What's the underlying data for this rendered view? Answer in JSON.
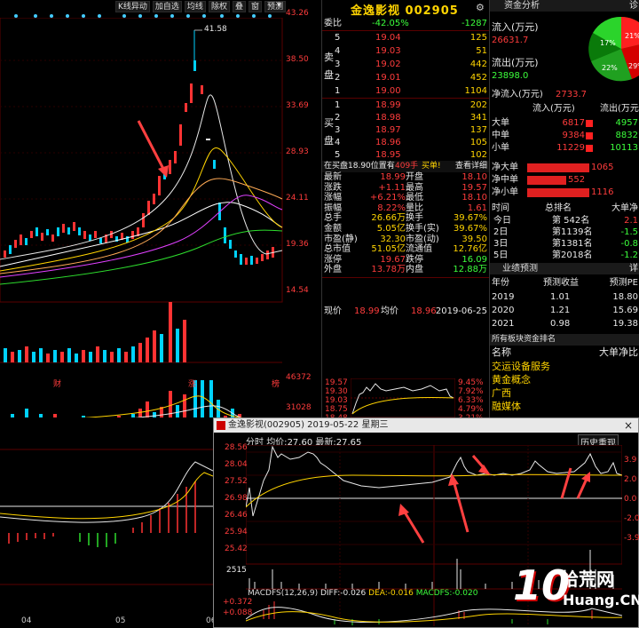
{
  "toolbar": [
    "K线异动",
    "加自选",
    "均线",
    "除权",
    "叠",
    "窗",
    "预测"
  ],
  "kline": {
    "prices": [
      "43.26",
      "38.50",
      "33.69",
      "28.93",
      "24.11",
      "19.36",
      "14.54"
    ],
    "peak": "41.58",
    "markers": [
      "财",
      "涨",
      "榜"
    ],
    "volume_axis": [
      "46372",
      "31028",
      "15685"
    ],
    "dates": [
      "04",
      "05",
      "06"
    ]
  },
  "quote": {
    "title": "金逸影视 002905",
    "weibi_label": "委比",
    "weibi_pct": "-42.05%",
    "weibi_diff": "-1287",
    "sell_label": [
      "卖",
      "盘"
    ],
    "buy_label": [
      "买",
      "盘"
    ],
    "sell": [
      {
        "lvl": "5",
        "price": "19.04",
        "vol": "125"
      },
      {
        "lvl": "4",
        "price": "19.03",
        "vol": "51"
      },
      {
        "lvl": "3",
        "price": "19.02",
        "vol": "442"
      },
      {
        "lvl": "2",
        "price": "19.01",
        "vol": "452"
      },
      {
        "lvl": "1",
        "price": "19.00",
        "vol": "1104"
      }
    ],
    "buy": [
      {
        "lvl": "1",
        "price": "18.99",
        "vol": "202"
      },
      {
        "lvl": "2",
        "price": "18.98",
        "vol": "341"
      },
      {
        "lvl": "3",
        "price": "18.97",
        "vol": "137"
      },
      {
        "lvl": "4",
        "price": "18.96",
        "vol": "105"
      },
      {
        "lvl": "5",
        "price": "18.95",
        "vol": "102"
      }
    ],
    "buy_notice": "在买盘18.90位置有",
    "buy_notice_vol": "409手",
    "buy_notice_btn": "买单!",
    "detail_btn": "查看详细",
    "stats": [
      {
        "l1": "最新",
        "v1": "18.99",
        "c1": "red",
        "l2": "开盘",
        "v2": "18.10",
        "c2": "red"
      },
      {
        "l1": "涨跌",
        "v1": "+1.11",
        "c1": "red",
        "l2": "最高",
        "v2": "19.57",
        "c2": "red"
      },
      {
        "l1": "涨幅",
        "v1": "+6.21%",
        "c1": "red",
        "l2": "最低",
        "v2": "18.10",
        "c2": "red"
      },
      {
        "l1": "振幅",
        "v1": "8.22%",
        "c1": "red",
        "l2": "量比",
        "v2": "1.61",
        "c2": "red"
      },
      {
        "l1": "总手",
        "v1": "26.66万",
        "c1": "yellow",
        "l2": "换手",
        "v2": "39.67%",
        "c2": "yellow"
      },
      {
        "l1": "金额",
        "v1": "5.05亿",
        "c1": "yellow",
        "l2": "换手(实)",
        "v2": "39.67%",
        "c2": "yellow"
      },
      {
        "l1": "市盈(静)",
        "v1": "32.30",
        "c1": "yellow",
        "l2": "市盈(动)",
        "v2": "39.50",
        "c2": "yellow"
      },
      {
        "l1": "总市值",
        "v1": "51.05亿",
        "c1": "yellow",
        "l2": "流通值",
        "v2": "12.76亿",
        "c2": "yellow"
      },
      {
        "l1": "涨停",
        "v1": "19.67",
        "c1": "red",
        "l2": "跌停",
        "v2": "16.09",
        "c2": "green"
      },
      {
        "l1": "外盘",
        "v1": "13.78万",
        "c1": "red",
        "l2": "内盘",
        "v2": "12.88万",
        "c2": "green"
      }
    ],
    "now_label": "现价",
    "now_price": "18.99",
    "avg_label": "均价",
    "avg_price": "18.96",
    "date": "2019-06-25",
    "mini_left": [
      "19.57",
      "19.30",
      "19.03",
      "18.75",
      "18.48"
    ],
    "mini_right": [
      "9.45%",
      "7.92%",
      "6.33%",
      "4.79%",
      "3.21%"
    ]
  },
  "right": {
    "header": "资金分析",
    "header_btn": "诊",
    "inflow_label": "流入(万元)",
    "inflow": "26631.7",
    "outflow_label": "流出(万元)",
    "outflow": "23898.0",
    "pie": [
      {
        "pct": "17%",
        "color": "#2bd42b"
      },
      {
        "pct": "21%",
        "color": "#ff2020"
      },
      {
        "pct": "22%",
        "color": "#20a020"
      },
      {
        "pct": "29%",
        "color": "#d40000"
      },
      {
        "pct": "11%",
        "color": "#0a7a0a"
      }
    ],
    "netflow_label": "净流入(万元)",
    "netflow": "2733.7",
    "flow_cols": [
      "流入(万元)",
      "流出(万元)"
    ],
    "flows": [
      {
        "name": "大单",
        "in": "6817",
        "out": "4957"
      },
      {
        "name": "中单",
        "in": "9384",
        "out": "8832"
      },
      {
        "name": "小单",
        "in": "11229",
        "out": "10113"
      }
    ],
    "net": [
      {
        "name": "净大单",
        "value": "1065"
      },
      {
        "name": "净中单",
        "value": "552"
      },
      {
        "name": "净小单",
        "value": "1116"
      }
    ],
    "rank_cols": [
      "时间",
      "总排名",
      "大单净"
    ],
    "rank": [
      {
        "t": "今日",
        "r": "第 542名",
        "v": "2.1"
      },
      {
        "t": "2日",
        "r": "第1139名",
        "v": "-1.5"
      },
      {
        "t": "3日",
        "r": "第1381名",
        "v": "-0.8"
      },
      {
        "t": "5日",
        "r": "第2018名",
        "v": "-1.2"
      }
    ],
    "forecast_header": "业绩预测",
    "forecast_btn": "详",
    "forecast_cols": [
      "年份",
      "预测收益",
      "预测PE"
    ],
    "forecast": [
      {
        "y": "2019",
        "e": "1.01",
        "pe": "18.80"
      },
      {
        "y": "2020",
        "e": "1.21",
        "pe": "15.69"
      },
      {
        "y": "2021",
        "e": "0.98",
        "pe": "19.38"
      }
    ],
    "board_header": "所有板块资金排名",
    "board_cols": [
      "名称",
      "大单净比"
    ],
    "boards": [
      "交运设备服务",
      "黄金概念",
      "广西",
      "融媒体"
    ]
  },
  "popup": {
    "title": "金逸影视(002905) 2019-05-22 星期三",
    "info_label": "分时",
    "avg_label": "均价:",
    "avg": "27.60",
    "last_label": "最新:",
    "last": "27.65",
    "history_btn": "历史重现",
    "close": "×",
    "left_axis": [
      "28.56",
      "28.04",
      "27.52",
      "26.98",
      "26.46",
      "25.94",
      "25.42"
    ],
    "right_axis": [
      "3.9",
      "2.0",
      "0.0",
      "-2.0",
      "-3.9"
    ],
    "vol_label": "2515",
    "macd_line": "MACDFS(12,26,9)",
    "diff_label": "DIFF:",
    "diff": "-0.026",
    "dea_label": "DEA:",
    "dea": "-0.016",
    "macd_label": "MACDFS:",
    "macd": "-0.020",
    "macd_axis": [
      "+0.372",
      "+0.088"
    ]
  },
  "watermark": {
    "num": "10",
    "site": "拾荒网",
    "domain": "Huang.CN"
  }
}
